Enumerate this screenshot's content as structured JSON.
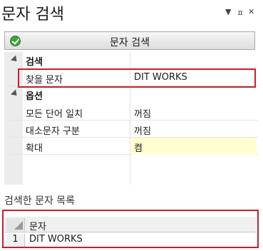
{
  "panel": {
    "title": "문자 검색",
    "controls": {
      "dropdown": "▼",
      "pin": "ㅍ",
      "close": "✕"
    }
  },
  "search_button": {
    "label": "문자 검색"
  },
  "property_grid": {
    "categories": [
      {
        "name": "검색",
        "props": [
          {
            "label": "찾을 문자",
            "value": "DIT WORKS"
          }
        ]
      },
      {
        "name": "옵션",
        "props": [
          {
            "label": "모든 단어 일치",
            "value": "꺼짐"
          },
          {
            "label": "대소문자 구분",
            "value": "꺼짐"
          },
          {
            "label": "확대",
            "value": "켬",
            "highlight": "#ffffd0"
          }
        ]
      }
    ]
  },
  "results": {
    "title": "검색한 문자 목록",
    "column_header": "문자",
    "rows": [
      {
        "num": "1",
        "value": "DIT WORKS"
      }
    ]
  },
  "colors": {
    "highlight_border": "#cc1c2a",
    "ok_icon": "#3aa53a"
  }
}
